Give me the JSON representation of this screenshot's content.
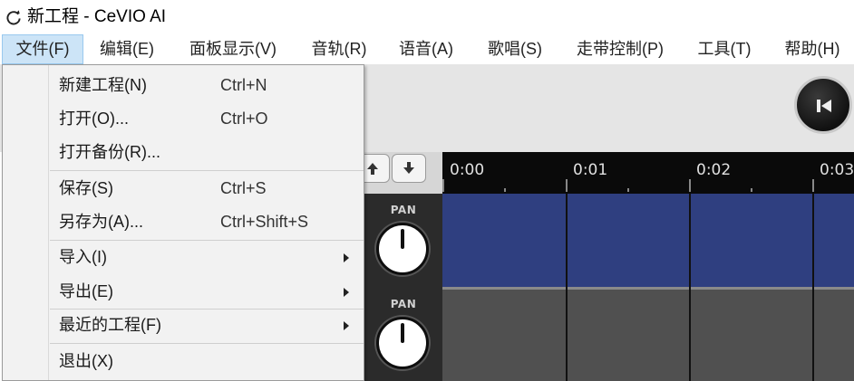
{
  "window": {
    "title": "新工程 - CeVIO AI",
    "app_icon": "cevio-refresh-icon"
  },
  "menubar": {
    "menus": [
      {
        "label": "文件(F)",
        "active": true
      },
      {
        "label": "编辑(E)"
      },
      {
        "label": "面板显示(V)"
      },
      {
        "label": "音轨(R)"
      },
      {
        "label": "语音(A)"
      },
      {
        "label": "歌唱(S)"
      },
      {
        "label": "走带控制(P)"
      },
      {
        "label": "工具(T)"
      },
      {
        "label": "帮助(H)"
      }
    ]
  },
  "file_menu": {
    "items": [
      {
        "label": "新建工程(N)",
        "shortcut": "Ctrl+N"
      },
      {
        "label": "打开(O)...",
        "shortcut": "Ctrl+O"
      },
      {
        "label": "打开备份(R)...",
        "shortcut": ""
      },
      {
        "label": "保存(S)",
        "shortcut": "Ctrl+S"
      },
      {
        "label": "另存为(A)...",
        "shortcut": "Ctrl+Shift+S"
      },
      {
        "label": "导入(I)",
        "shortcut": "",
        "submenu": true
      },
      {
        "label": "导出(E)",
        "shortcut": "",
        "submenu": true
      },
      {
        "label": "最近的工程(F)",
        "shortcut": "",
        "submenu": true
      },
      {
        "label": "退出(X)",
        "shortcut": ""
      }
    ]
  },
  "transport": {
    "rewind_icon": "skip-to-start-icon"
  },
  "track_nav": {
    "up_icon": "arrow-up-icon",
    "down_icon": "arrow-down-icon"
  },
  "timeline": {
    "markers": [
      "0:00",
      "0:01",
      "0:02",
      "0:03"
    ]
  },
  "tracks": [
    {
      "pan_label": "PAN",
      "color": "#2f3f80"
    },
    {
      "pan_label": "PAN",
      "color": "#505050"
    }
  ],
  "colors": {
    "menu_highlight": "#cce4f7",
    "menu_highlight_border": "#99c9ef",
    "track_active": "#2f3f80",
    "track_inactive": "#505050",
    "ruler_bg": "#0a0a0a"
  }
}
